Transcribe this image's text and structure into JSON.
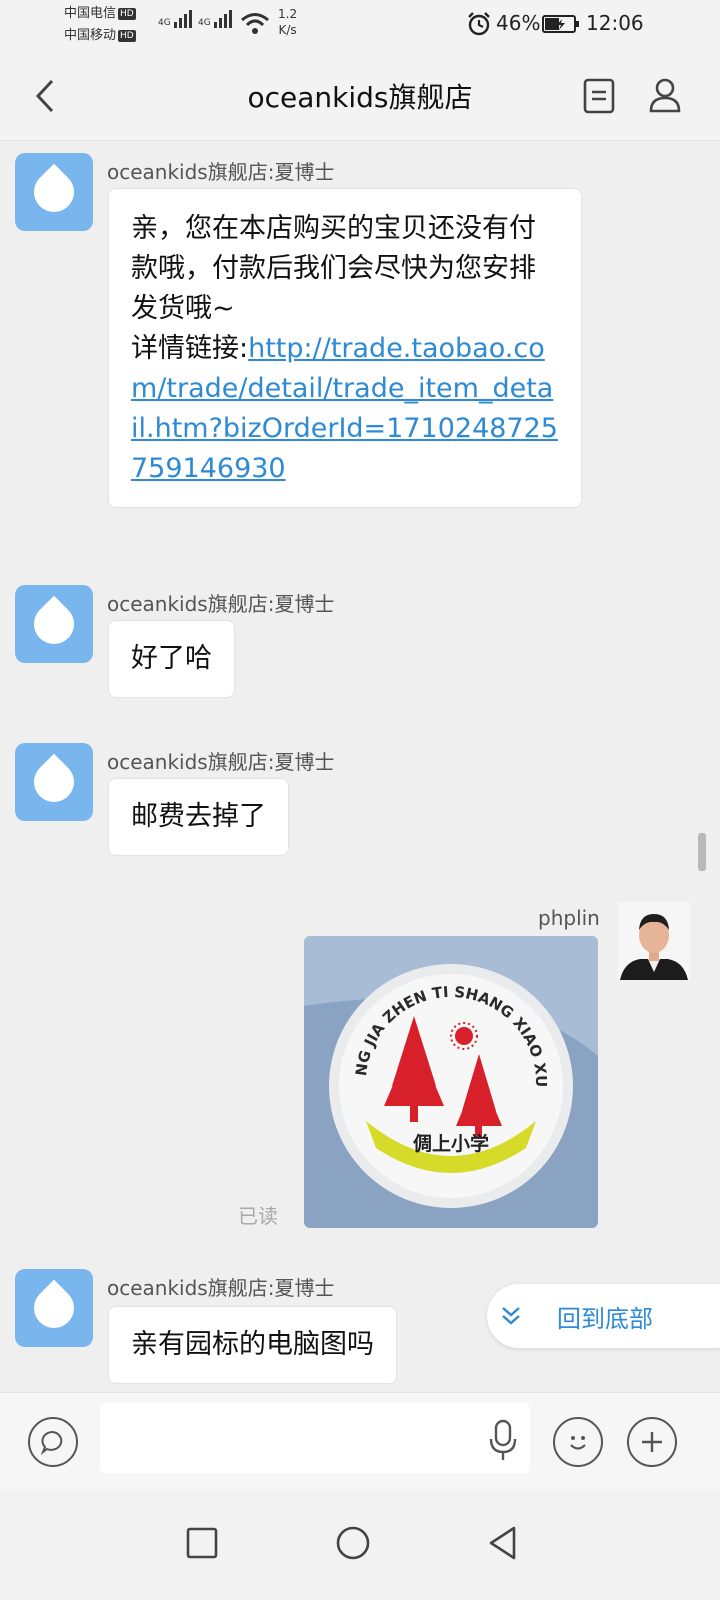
{
  "status_bar": {
    "carrier1": "中国电信",
    "carrier2": "中国移动",
    "hd": "HD",
    "net1": "4G",
    "net2": "4G",
    "speed_value": "1.2",
    "speed_unit": "K/s",
    "battery": "46%",
    "time": "12:06"
  },
  "header": {
    "title": "oceankids旗舰店"
  },
  "messages": [
    {
      "sender": "oceankids旗舰店:夏博士",
      "text": "亲，您在本店购买的宝贝还没有付款哦，付款后我们会尽快为您安排发货哦~",
      "link_label": "详情链接:",
      "link_url": "http://trade.taobao.com/trade/detail/trade_item_detail.htm?bizOrderId=1710248725759146930"
    },
    {
      "sender": "oceankids旗舰店:夏博士",
      "text": "好了哈"
    },
    {
      "sender": "oceankids旗舰店:夏博士",
      "text": "邮费去掉了"
    },
    {
      "sender": "phplin",
      "read_status": "已读",
      "badge_text": "YANG JIA ZHEN TI SHANG XIAO XUE",
      "badge_cn": "倜上小学"
    },
    {
      "sender": "oceankids旗舰店:夏博士",
      "text": "亲有园标的电脑图吗"
    }
  ],
  "scroll_bottom_label": "回到底部",
  "colors": {
    "link": "#2e8ad4",
    "bot_avatar": "#7ab6ee",
    "badge_red": "#d8202a",
    "badge_yellow": "#d6db2a"
  }
}
